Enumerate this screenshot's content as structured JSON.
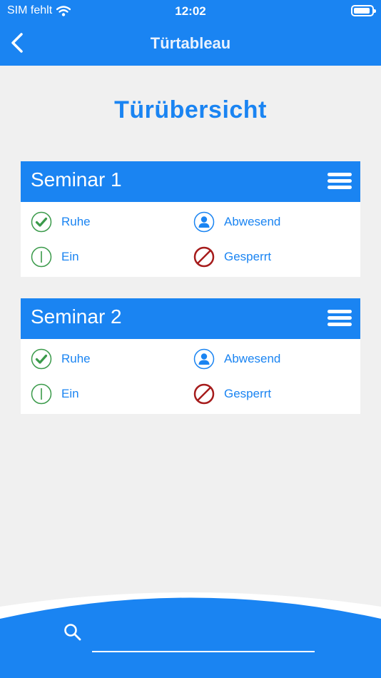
{
  "status_bar": {
    "carrier": "SIM fehlt",
    "time": "12:02"
  },
  "navbar": {
    "title": "Türtableau"
  },
  "page": {
    "title": "Türübersicht"
  },
  "cards": [
    {
      "title": "Seminar 1",
      "statuses": {
        "rest": "Ruhe",
        "absent": "Abwesend",
        "on": "Ein",
        "locked": "Gesperrt"
      }
    },
    {
      "title": "Seminar 2",
      "statuses": {
        "rest": "Ruhe",
        "absent": "Abwesend",
        "on": "Ein",
        "locked": "Gesperrt"
      }
    }
  ],
  "search": {
    "placeholder": ""
  },
  "colors": {
    "accent": "#1a84f2",
    "green": "#3a9a4a",
    "red": "#a61c1c",
    "background": "#f0f0f0"
  },
  "icons": [
    "back-chevron-icon",
    "wifi-icon",
    "battery-icon",
    "menu-icon",
    "check-circle-icon",
    "user-circle-icon",
    "power-circle-icon",
    "blocked-circle-icon",
    "search-icon"
  ]
}
